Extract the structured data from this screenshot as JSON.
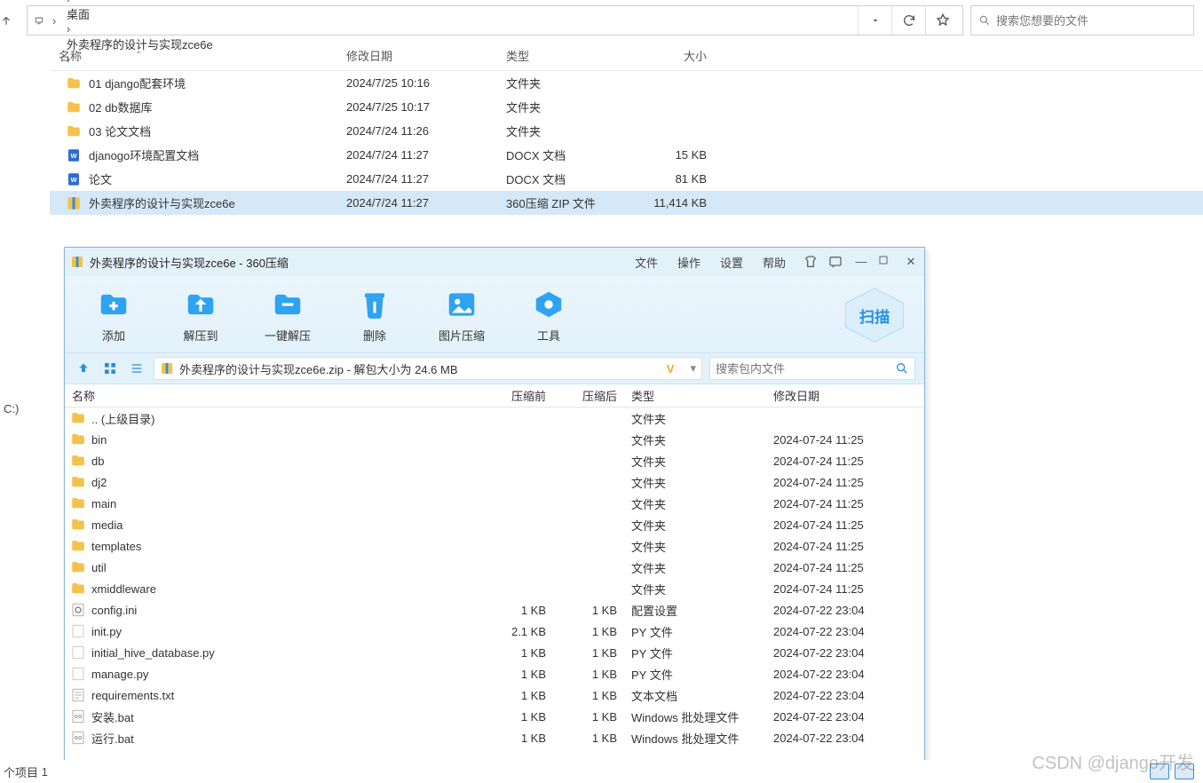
{
  "explorer": {
    "breadcrumb": [
      "此电脑",
      "桌面",
      "外卖程序的设计与实现zce6e"
    ],
    "search_placeholder": "搜索您想要的文件",
    "columns": {
      "name": "名称",
      "date": "修改日期",
      "type": "类型",
      "size": "大小"
    },
    "rows": [
      {
        "icon": "folder",
        "name": "01 django配套环境",
        "date": "2024/7/25 10:16",
        "type": "文件夹",
        "size": ""
      },
      {
        "icon": "folder",
        "name": "02 db数据库",
        "date": "2024/7/25 10:17",
        "type": "文件夹",
        "size": ""
      },
      {
        "icon": "folder",
        "name": "03 论文文档",
        "date": "2024/7/24 11:26",
        "type": "文件夹",
        "size": ""
      },
      {
        "icon": "docx",
        "name": "djanogo环境配置文档",
        "date": "2024/7/24 11:27",
        "type": "DOCX 文档",
        "size": "15 KB"
      },
      {
        "icon": "docx",
        "name": "论文",
        "date": "2024/7/24 11:27",
        "type": "DOCX 文档",
        "size": "81 KB"
      },
      {
        "icon": "zip",
        "name": "外卖程序的设计与实现zce6e",
        "date": "2024/7/24 11:27",
        "type": "360压缩 ZIP 文件",
        "size": "11,414 KB",
        "selected": true
      }
    ],
    "drive_label": "C:)",
    "status_prefix": "个项目",
    "status_count": "1"
  },
  "zip": {
    "title": "外卖程序的设计与实现zce6e - 360压缩",
    "menu": [
      "文件",
      "操作",
      "设置",
      "帮助"
    ],
    "toolbar": [
      {
        "id": "add",
        "label": "添加"
      },
      {
        "id": "extract-to",
        "label": "解压到"
      },
      {
        "id": "extract-one",
        "label": "一键解压"
      },
      {
        "id": "delete",
        "label": "删除"
      },
      {
        "id": "img-compress",
        "label": "图片压缩"
      },
      {
        "id": "tools",
        "label": "工具"
      }
    ],
    "scan_label": "扫描",
    "path_text": "外卖程序的设计与实现zce6e.zip - 解包大小为 24.6 MB",
    "path_v": "V",
    "inner_search_placeholder": "搜索包内文件",
    "columns": {
      "name": "名称",
      "pre": "压缩前",
      "post": "压缩后",
      "type": "类型",
      "date": "修改日期"
    },
    "rows": [
      {
        "icon": "folder",
        "name": ".. (上级目录)",
        "pre": "",
        "post": "",
        "type": "文件夹",
        "date": ""
      },
      {
        "icon": "folder",
        "name": "bin",
        "pre": "",
        "post": "",
        "type": "文件夹",
        "date": "2024-07-24 11:25"
      },
      {
        "icon": "folder",
        "name": "db",
        "pre": "",
        "post": "",
        "type": "文件夹",
        "date": "2024-07-24 11:25"
      },
      {
        "icon": "folder",
        "name": "dj2",
        "pre": "",
        "post": "",
        "type": "文件夹",
        "date": "2024-07-24 11:25"
      },
      {
        "icon": "folder",
        "name": "main",
        "pre": "",
        "post": "",
        "type": "文件夹",
        "date": "2024-07-24 11:25"
      },
      {
        "icon": "folder",
        "name": "media",
        "pre": "",
        "post": "",
        "type": "文件夹",
        "date": "2024-07-24 11:25"
      },
      {
        "icon": "folder",
        "name": "templates",
        "pre": "",
        "post": "",
        "type": "文件夹",
        "date": "2024-07-24 11:25"
      },
      {
        "icon": "folder",
        "name": "util",
        "pre": "",
        "post": "",
        "type": "文件夹",
        "date": "2024-07-24 11:25"
      },
      {
        "icon": "folder",
        "name": "xmiddleware",
        "pre": "",
        "post": "",
        "type": "文件夹",
        "date": "2024-07-24 11:25"
      },
      {
        "icon": "ini",
        "name": "config.ini",
        "pre": "1 KB",
        "post": "1 KB",
        "type": "配置设置",
        "date": "2024-07-22 23:04"
      },
      {
        "icon": "file",
        "name": "init.py",
        "pre": "2.1 KB",
        "post": "1 KB",
        "type": "PY 文件",
        "date": "2024-07-22 23:04"
      },
      {
        "icon": "file",
        "name": "initial_hive_database.py",
        "pre": "1 KB",
        "post": "1 KB",
        "type": "PY 文件",
        "date": "2024-07-22 23:04"
      },
      {
        "icon": "file",
        "name": "manage.py",
        "pre": "1 KB",
        "post": "1 KB",
        "type": "PY 文件",
        "date": "2024-07-22 23:04"
      },
      {
        "icon": "txt",
        "name": "requirements.txt",
        "pre": "1 KB",
        "post": "1 KB",
        "type": "文本文档",
        "date": "2024-07-22 23:04"
      },
      {
        "icon": "bat",
        "name": "安装.bat",
        "pre": "1 KB",
        "post": "1 KB",
        "type": "Windows 批处理文件",
        "date": "2024-07-22 23:04"
      },
      {
        "icon": "bat",
        "name": "运行.bat",
        "pre": "1 KB",
        "post": "1 KB",
        "type": "Windows 批处理文件",
        "date": "2024-07-22 23:04"
      }
    ]
  },
  "watermark": "CSDN @django开发"
}
